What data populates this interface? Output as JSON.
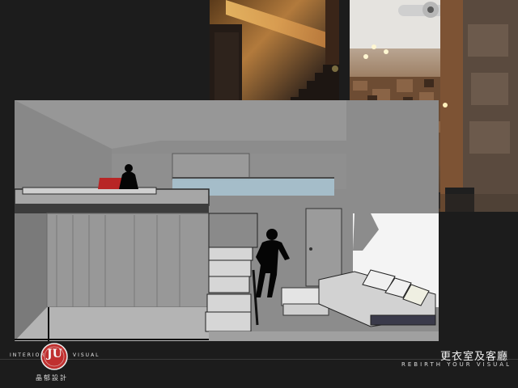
{
  "brand": {
    "left_word": "INTERIOR",
    "right_word": "VISUAL",
    "logo_text": "JU",
    "chinese_name": "晶郁設計"
  },
  "caption": {
    "title": "更衣室及客廳",
    "subtitle": "REBIRTH YOUR VISUAL"
  },
  "colors": {
    "background": "#1c1c1c",
    "render_grey": "#8a8a8a",
    "glass": "#a9c6d4",
    "accent_red": "#b82626",
    "logo_red": "#c0302f"
  },
  "images": [
    {
      "name": "photo-stair-wall-light"
    },
    {
      "name": "photo-salon-chairs"
    },
    {
      "name": "render-section-view"
    }
  ]
}
